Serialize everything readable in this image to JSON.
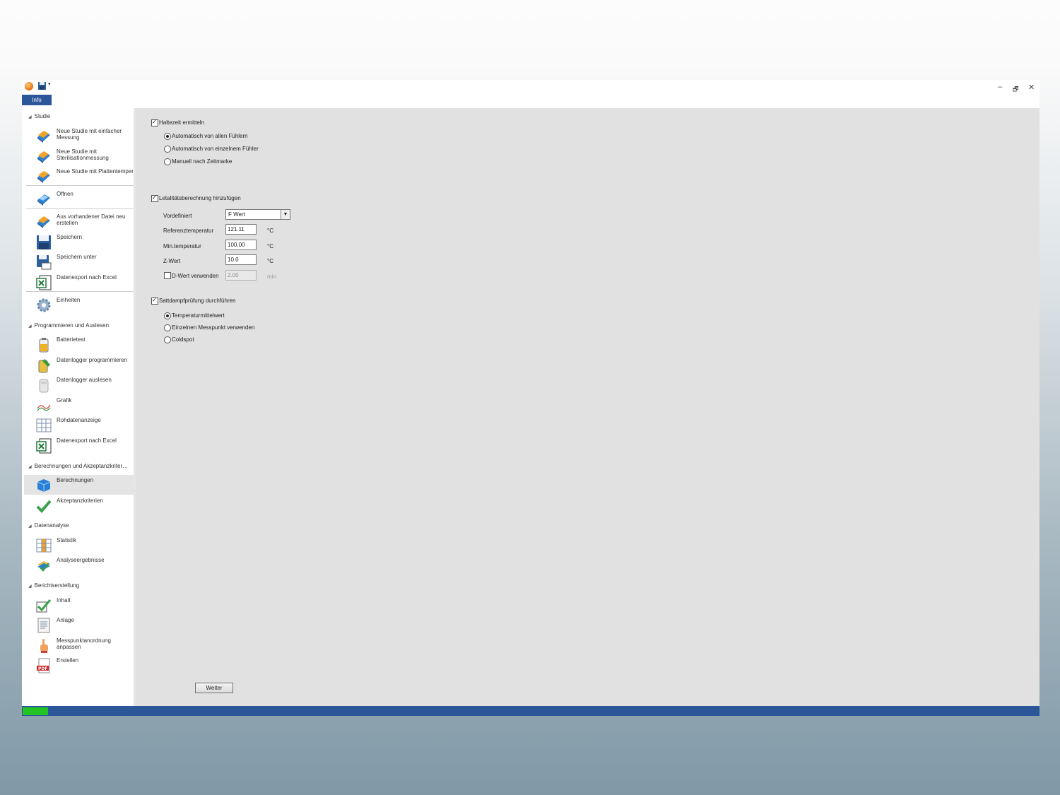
{
  "window": {
    "info_tab": "Info",
    "controls": {
      "minimize": "–",
      "restore": "🗗",
      "close": "✕"
    }
  },
  "sidebar": {
    "groups": [
      {
        "label": "Studie"
      },
      {
        "label": "Programmieren und Auslesen"
      },
      {
        "label": "Berechnungen und Akzeptanzkriter…"
      },
      {
        "label": "Datenanalyse"
      },
      {
        "label": "Berichtserstellung"
      }
    ],
    "items": [
      {
        "label": "Neue Studie mit einfacher Messung",
        "icon": "new-study-book-icon"
      },
      {
        "label": "Neue Studie mit Sterilisationmessung",
        "icon": "new-study-book-icon"
      },
      {
        "label": "Neue Studie mit Plattentemperaturverteilungs",
        "icon": "new-study-book-icon"
      },
      {
        "label": "Öffnen",
        "icon": "open-book-icon"
      },
      {
        "label": "Aus vorhandener Datei neu erstellen",
        "icon": "new-from-file-icon"
      },
      {
        "label": "Speichern",
        "icon": "save-disk-icon"
      },
      {
        "label": "Speichern unter",
        "icon": "save-as-disk-icon"
      },
      {
        "label": "Datenexport nach Excel",
        "icon": "excel-icon"
      },
      {
        "label": "Einheiten",
        "icon": "gear-icon"
      },
      {
        "label": "Batterietest",
        "icon": "battery-icon"
      },
      {
        "label": "Datenlogger programmieren",
        "icon": "logger-program-icon"
      },
      {
        "label": "Datenlogger auslesen",
        "icon": "logger-read-icon"
      },
      {
        "label": "Grafik",
        "icon": "graph-icon"
      },
      {
        "label": "Rohdatenanzeige",
        "icon": "grid-table-icon"
      },
      {
        "label": "Datenexport nach Excel",
        "icon": "excel-icon"
      },
      {
        "label": "Berechnungen",
        "icon": "calculation-icon"
      },
      {
        "label": "Akzeptanzkriterien",
        "icon": "checkmark-icon"
      },
      {
        "label": "Statistik",
        "icon": "statistics-table-icon"
      },
      {
        "label": "Analyseergebnisse",
        "icon": "analysis-results-icon"
      },
      {
        "label": "Inhalt",
        "icon": "content-check-icon"
      },
      {
        "label": "Anlage",
        "icon": "document-icon"
      },
      {
        "label": "Messpunktanordnung anpassen",
        "icon": "hand-pointer-icon"
      },
      {
        "label": "Erstellen",
        "icon": "pdf-icon"
      }
    ],
    "selected_item": "Berechnungen"
  },
  "form": {
    "holding_time": {
      "label": "Haltezeit ermitteln",
      "checked": true,
      "options": [
        "Automatisch von allen Fühlern",
        "Automatisch von einzelnem Fühler",
        "Manuell nach Zeitmarke"
      ],
      "selected": "Automatisch von allen Fühlern"
    },
    "lethality": {
      "label": "Letalitätsberechnung hinzufügen",
      "checked": true,
      "predefined_label": "Vordefiniert",
      "predefined_value": "F Wert",
      "ref_temp_label": "Referenztemperatur",
      "ref_temp_value": "121.11",
      "min_temp_label": "Min.temperatur",
      "min_temp_value": "100.00",
      "z_label": "Z-Wert",
      "z_value": "10.0",
      "unit_c": "°C",
      "d_value_label": "D-Wert verwenden",
      "d_value_checked": false,
      "d_value": "2.00",
      "d_unit": "min"
    },
    "saturated_steam": {
      "label": "Sattdampfprüfung durchführen",
      "checked": true,
      "options": [
        "Temperaturmittelwert",
        "Einzelnen Messpunkt verwenden",
        "Coldspot"
      ],
      "selected": "Temperaturmittelwert"
    },
    "next_button": "Weiter"
  },
  "colors": {
    "accent": "#2b579a",
    "progress": "#22c322",
    "content_bg": "#e1e1e1"
  }
}
